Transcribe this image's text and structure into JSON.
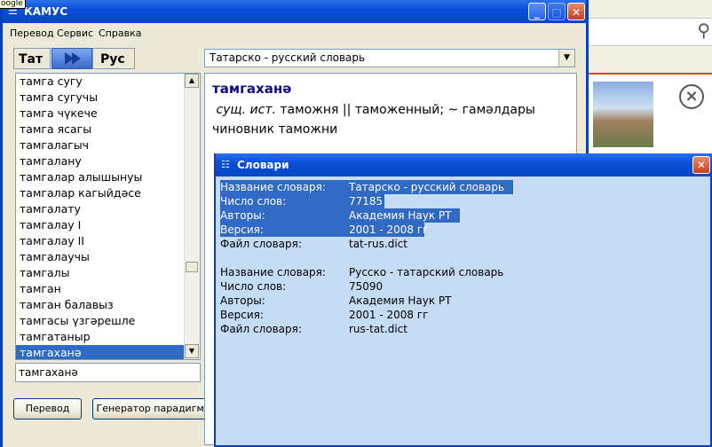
{
  "tooltip": "oogle",
  "window": {
    "title": "КАМУС",
    "minimize": "_",
    "maximize": "□",
    "close": "✕"
  },
  "menu": [
    "Перевод",
    "Сервис",
    "Справка"
  ],
  "lang": {
    "from": "Тат",
    "to": "Рус"
  },
  "dict_select": {
    "value": "Татарско - русский словарь"
  },
  "wordlist": {
    "items": [
      "тамга сугу",
      "тамга сугучы",
      "тамга чүкече",
      "тамга ясагы",
      "тамгалагыч",
      "тамгалану",
      "тамгалар алышынуы",
      "тамгалар кагыйдәсе",
      "тамгалату",
      "тамгалау I",
      "тамгалау II",
      "тамгалаучы",
      "тамгалы",
      "тамган",
      "тамган балавыз",
      "тамгасы үзгәрешле",
      "тамгатаныр",
      "тамгаханә"
    ],
    "selected_index": 17
  },
  "search": {
    "value": "тамгаханә"
  },
  "buttons": {
    "translate": "Перевод",
    "paradigm": "Генератор парадигмы"
  },
  "article": {
    "headword": "тамгаханә",
    "grammar": "сущ. ист.",
    "line1": "таможня || таможенный; ~ гамәлдары",
    "line2": "чиновник таможни"
  },
  "dialog": {
    "title": "Словари",
    "close": "✕",
    "dictionaries": [
      {
        "rows": [
          {
            "label": "Название словаря:",
            "value": "Татарско - русский словарь"
          },
          {
            "label": "Число слов:",
            "value": "77185"
          },
          {
            "label": "Авторы:",
            "value": "Академия Наук РТ"
          },
          {
            "label": "Версия:",
            "value": "2001 - 2008 гг"
          },
          {
            "label": "Файл словаря:",
            "value": "tat-rus.dict"
          }
        ]
      },
      {
        "rows": [
          {
            "label": "Название словаря:",
            "value": "Русско - татарский словарь"
          },
          {
            "label": "Число слов:",
            "value": "75090"
          },
          {
            "label": "Авторы:",
            "value": "Академия Наук РТ"
          },
          {
            "label": "Версия:",
            "value": "2001 - 2008 гг"
          },
          {
            "label": "Файл словаря:",
            "value": "rus-tat.dict"
          }
        ]
      }
    ]
  },
  "colors": {
    "titlebar": "#0b4fd8",
    "selection": "#316ac5",
    "dialog_bg": "#c5dcf4"
  }
}
